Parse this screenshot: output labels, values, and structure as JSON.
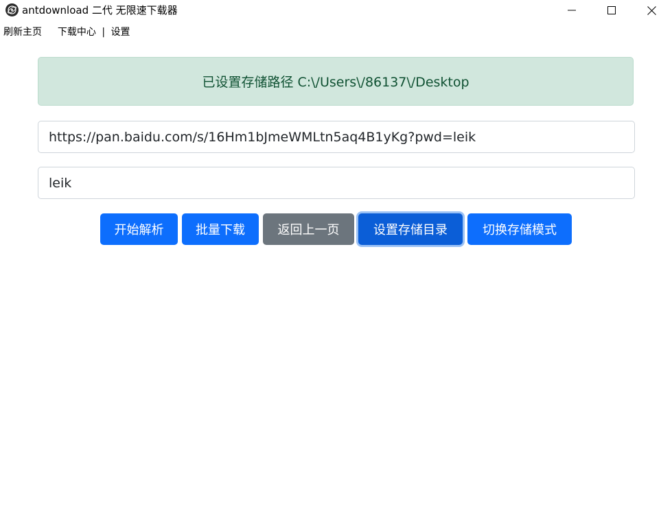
{
  "window": {
    "title": "antdownload 二代 无限速下载器",
    "icon": "app-logo-icon",
    "controls": {
      "minimize_icon": "minimize-icon",
      "maximize_icon": "maximize-icon",
      "close_icon": "close-icon"
    }
  },
  "menu": {
    "items": [
      {
        "label": "刷新主页"
      },
      {
        "label": "下载中心"
      },
      {
        "label": "设置"
      }
    ],
    "separator": "|"
  },
  "alert": {
    "text": "已设置存储路径 C:\\/Users\\/86137\\/Desktop",
    "color": "#0f5132",
    "background": "#d1e7dd"
  },
  "form": {
    "url_value": "https://pan.baidu.com/s/16Hm1bJmeWMLtn5aq4B1yKg?pwd=leik",
    "password_value": "leik"
  },
  "buttons": {
    "parse": "开始解析",
    "batch_download": "批量下载",
    "back": "返回上一页",
    "set_storage_dir": "设置存储目录",
    "switch_storage_mode": "切换存储模式"
  },
  "colors": {
    "primary": "#0d6efd",
    "secondary": "#6c757d",
    "focused_primary": "#0b5ed7"
  }
}
